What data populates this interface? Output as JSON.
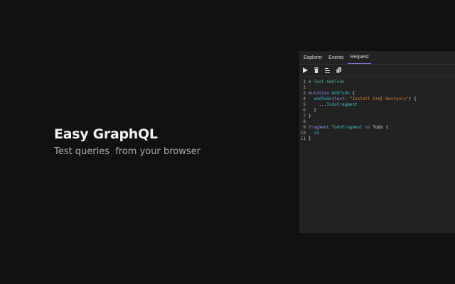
{
  "hero": {
    "title": "Easy GraphQL",
    "subtitle": "Test queries  from your browser"
  },
  "panel": {
    "tabs": [
      {
        "label": "Explorer"
      },
      {
        "label": "Events"
      },
      {
        "label": "Request",
        "active": true
      }
    ],
    "toolbar": [
      "play-icon",
      "trash-icon",
      "format-icon",
      "copy-icon"
    ],
    "code": [
      [
        {
          "t": "# Test AddTodo",
          "c": "comment"
        }
      ],
      [],
      [
        {
          "t": "mutation ",
          "c": "kw"
        },
        {
          "t": "AddTodo",
          "c": "name"
        },
        {
          "t": " {",
          "c": "punc"
        }
      ],
      [
        {
          "t": "  addTodo",
          "c": "name"
        },
        {
          "t": "(",
          "c": "punc"
        },
        {
          "t": "text",
          "c": "arg"
        },
        {
          "t": ": ",
          "c": "punc"
        },
        {
          "t": "\"Install Urql Devtools\"",
          "c": "str"
        },
        {
          "t": ") {",
          "c": "punc"
        }
      ],
      [
        {
          "t": "    ...",
          "c": "punc"
        },
        {
          "t": "TodoFragment",
          "c": "name"
        }
      ],
      [
        {
          "t": "  }",
          "c": "punc"
        }
      ],
      [
        {
          "t": "}",
          "c": "punc"
        }
      ],
      [],
      [
        {
          "t": "fragment ",
          "c": "kw"
        },
        {
          "t": "TodoFragment",
          "c": "name"
        },
        {
          "t": " on ",
          "c": "kw"
        },
        {
          "t": "Todo",
          "c": "punc"
        },
        {
          "t": " {",
          "c": "punc"
        }
      ],
      [
        {
          "t": "  id",
          "c": "name"
        }
      ],
      [
        {
          "t": "}",
          "c": "punc"
        }
      ]
    ]
  }
}
